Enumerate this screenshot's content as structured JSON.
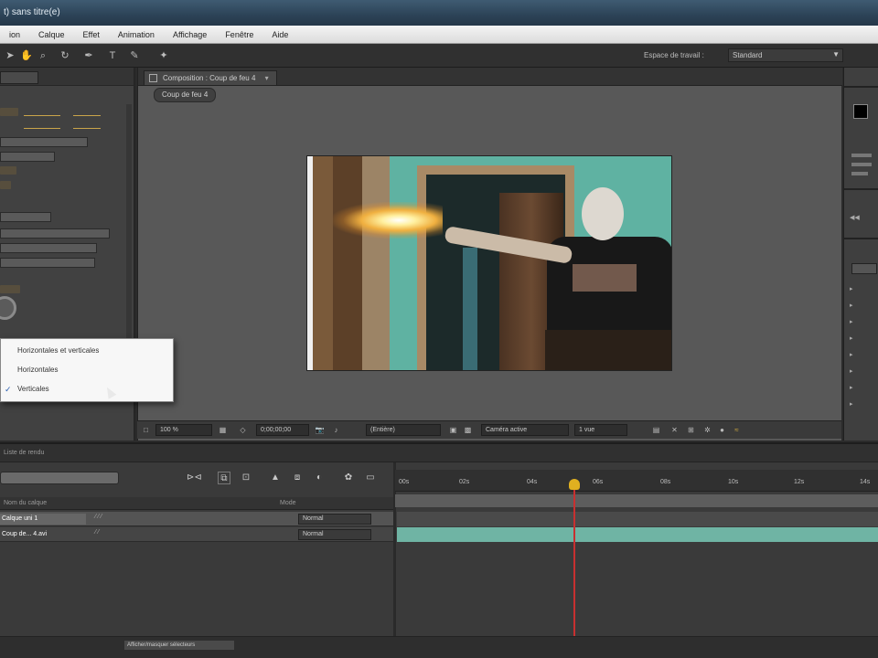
{
  "window": {
    "title": "t) sans titre(e)"
  },
  "menu": [
    "ion",
    "Calque",
    "Effet",
    "Animation",
    "Affichage",
    "Fenêtre",
    "Aide"
  ],
  "toolbar": {
    "workspace_label": "Espace de travail :",
    "workspace_value": "Standard"
  },
  "composition": {
    "tab_label": "Composition : Coup de feu 4",
    "breadcrumb": "Coup de feu 4",
    "zoom": "100 %",
    "timecode": "0;00;00;00",
    "resolution": "(Entière)",
    "view": "Caméra active",
    "views_count": "1 vue"
  },
  "popup_menu": {
    "items": [
      {
        "label": "Horizontales et verticales",
        "checked": false
      },
      {
        "label": "Horizontales",
        "checked": false
      },
      {
        "label": "Verticales",
        "checked": true
      }
    ]
  },
  "timeline": {
    "panel_label": "Liste de rendu",
    "column_source": "Nom du calque",
    "column_mode": "Mode",
    "ruler_ticks": [
      "00s",
      "02s",
      "04s",
      "06s",
      "08s",
      "10s",
      "12s",
      "14s"
    ],
    "layers": [
      {
        "name": "Calque uni 1",
        "mode": "Normal",
        "selected": true
      },
      {
        "name": "Coup de... 4.avi",
        "mode": "Normal",
        "selected": false
      }
    ],
    "status": "Afficher/masquer sélecteurs"
  },
  "colors": {
    "accent_layer_bar": "#6fb4a4",
    "playhead": "#e0b020",
    "playhead_line": "#c83030"
  }
}
